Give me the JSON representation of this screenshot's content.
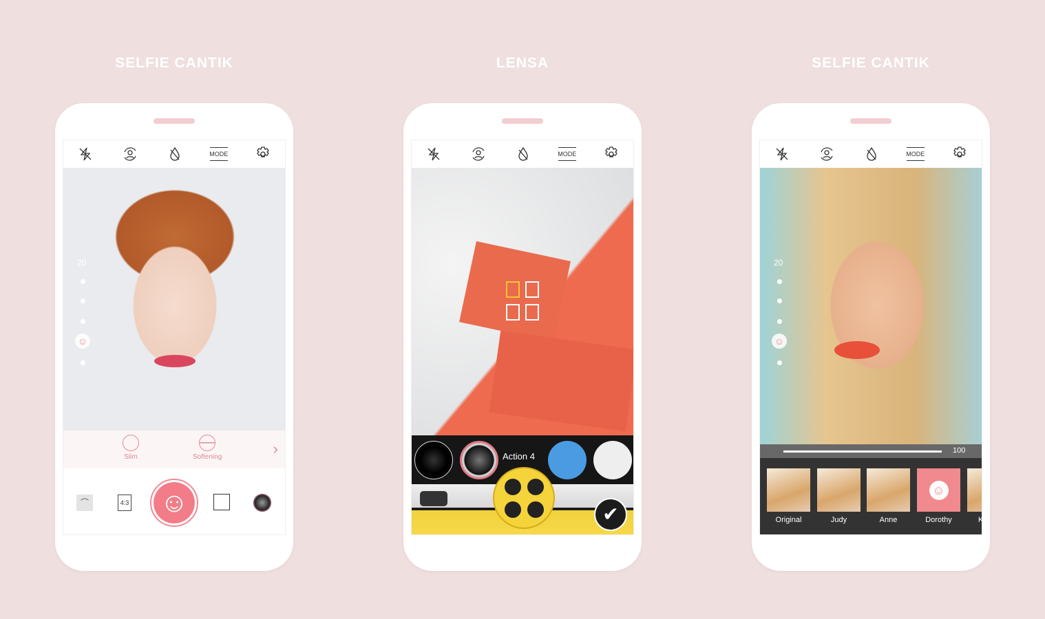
{
  "titles": [
    "SELFIE CANTIK",
    "LENSA",
    "SELFIE CANTIK"
  ],
  "toolbar_icons": [
    "flash-off-icon",
    "switch-camera-icon",
    "drop-off-icon",
    "mode-icon",
    "gear-icon"
  ],
  "toolbar_mode_label": "MODE",
  "phone1": {
    "slider_value": "20",
    "beauty_items": [
      {
        "label": "Slim",
        "icon": "face-slim-icon"
      },
      {
        "label": "Softening",
        "icon": "softening-icon"
      }
    ],
    "aspect_ratio": "4:3",
    "accent": "#f27d88"
  },
  "phone2": {
    "lens_label": "Action 4",
    "lens_colors": {
      "yellow": "#f5d33a",
      "blue": "#4a9be2"
    }
  },
  "phone3": {
    "slider_value": "20",
    "intensity": "100",
    "filters": [
      "Original",
      "Judy",
      "Anne",
      "Dorothy",
      "K"
    ]
  }
}
